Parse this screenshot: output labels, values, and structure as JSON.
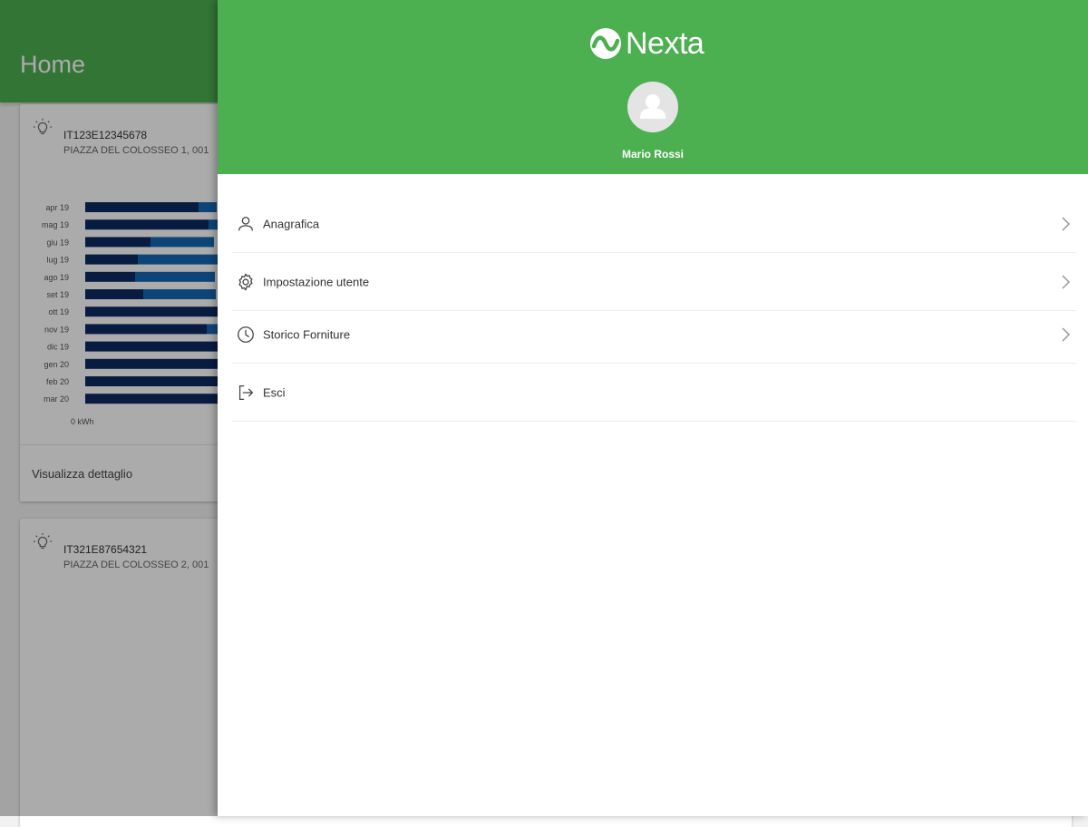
{
  "app_bar": {
    "title": "Home"
  },
  "cards": [
    {
      "pod": "IT123E12345678",
      "address": "PIAZZA DEL COLOSSEO 1, 001",
      "chart_zero_label": "0 kWh",
      "detail_link": "Visualizza dettaglio"
    },
    {
      "pod": "IT321E87654321",
      "address": "PIAZZA DEL COLOSSEO 2, 001"
    }
  ],
  "chart_data": {
    "type": "bar",
    "orientation": "horizontal",
    "stacked": true,
    "categories": [
      "apr 19",
      "mag 19",
      "giu 19",
      "lug 19",
      "ago 19",
      "set 19",
      "ott 19",
      "nov 19",
      "dic 19",
      "gen 20",
      "feb 20",
      "mar 20"
    ],
    "series": [
      {
        "values": [
          125,
          136,
          72,
          58,
          55,
          64,
          150,
          134,
          150,
          150,
          150,
          150
        ]
      },
      {
        "values": [
          20,
          14,
          70,
          88,
          88,
          80,
          0,
          16,
          0,
          0,
          0,
          0
        ]
      }
    ],
    "colors": [
      "#0d2a63",
      "#1668b5"
    ],
    "xlabel": "",
    "ylabel": ""
  },
  "drawer": {
    "brand": "Nexta",
    "user_name": "Mario Rossi",
    "menu": [
      {
        "label": "Anagrafica",
        "icon": "person-icon",
        "has_chevron": true
      },
      {
        "label": "Impostazione utente",
        "icon": "gear-icon",
        "has_chevron": true
      },
      {
        "label": "Storico Forniture",
        "icon": "clock-icon",
        "has_chevron": true
      },
      {
        "label": "Esci",
        "icon": "logout-icon",
        "has_chevron": false
      }
    ]
  },
  "colors": {
    "primary_green": "#4caf50",
    "scrim": "rgba(0,0,0,0.33)"
  }
}
